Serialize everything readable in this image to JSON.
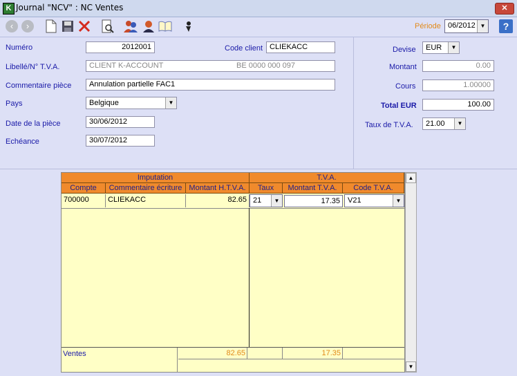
{
  "window": {
    "title": "Journal \"NCV\" : NC Ventes",
    "close_label": "✕",
    "app_icon_letter": "K"
  },
  "toolbar": {
    "periode_label": "Période",
    "periode_value": "06/2012",
    "help_label": "?"
  },
  "form": {
    "numero_label": "Numéro",
    "numero_value": "2012001",
    "code_client_label": "Code client",
    "code_client_value": "CLIEKACC",
    "libelle_label": "Libellé/N° T.V.A.",
    "libelle_value": "CLIENT K-ACCOUNT",
    "tva_number_value": "BE 0000 000 097",
    "commentaire_label": "Commentaire pièce",
    "commentaire_value": "Annulation partielle FAC1",
    "pays_label": "Pays",
    "pays_value": "Belgique",
    "date_label": "Date de la pièce",
    "date_value": "30/06/2012",
    "echeance_label": "Echéance",
    "echeance_value": "30/07/2012"
  },
  "right_panel": {
    "devise_label": "Devise",
    "devise_value": "EUR",
    "montant_label": "Montant",
    "montant_value": "0.00",
    "cours_label": "Cours",
    "cours_value": "1.00000",
    "total_label": "Total EUR",
    "total_value": "100.00",
    "taux_label": "Taux de T.V.A.",
    "taux_value": "21.00"
  },
  "grid": {
    "group_imputation": "Imputation",
    "group_tva": "T.V.A.",
    "columns": [
      "Compte",
      "Commentaire écriture",
      "Montant H.T.V.A.",
      "Taux",
      "Montant T.V.A.",
      "Code T.V.A."
    ],
    "rows": [
      {
        "compte": "700000",
        "commentaire": "CLIEKACC",
        "montant_htva": "82.65",
        "taux": "21",
        "montant_tva": "17.35",
        "code_tva": "V21"
      }
    ],
    "footer": {
      "label": "Ventes",
      "total_htva": "82.65",
      "total_tva": "17.35"
    }
  },
  "colors": {
    "accent_orange": "#f08a2c",
    "label_blue": "#1a1aa8",
    "grid_bg": "#ffffc6",
    "window_bg": "#dde0f6"
  }
}
